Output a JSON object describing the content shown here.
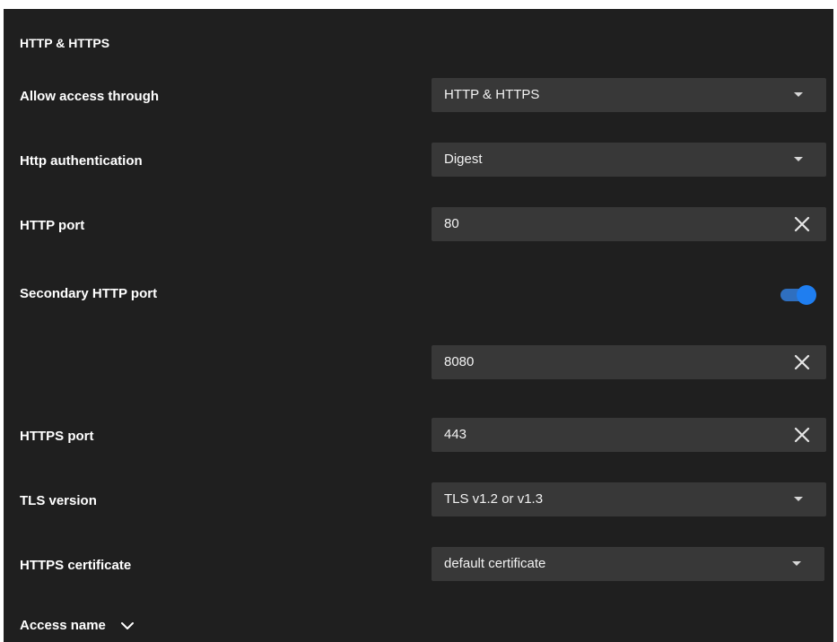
{
  "section": {
    "title": "HTTP & HTTPS"
  },
  "fields": {
    "allow_access": {
      "label": "Allow access through",
      "value": "HTTP & HTTPS"
    },
    "http_auth": {
      "label": "Http authentication",
      "value": "Digest"
    },
    "http_port": {
      "label": "HTTP port",
      "value": "80"
    },
    "secondary_http_port": {
      "label": "Secondary HTTP port",
      "enabled": true,
      "value": "8080"
    },
    "https_port": {
      "label": "HTTPS port",
      "value": "443"
    },
    "tls_version": {
      "label": "TLS version",
      "value": "TLS v1.2 or v1.3"
    },
    "https_certificate": {
      "label": "HTTPS certificate",
      "value": "default certificate"
    }
  },
  "access_name": {
    "label": "Access name",
    "icon": "chevron-down-icon"
  },
  "icons": {
    "clear": "close-icon",
    "dropdown": "caret-down-icon"
  },
  "colors": {
    "panel_bg": "#1f1f1f",
    "control_bg": "#383838",
    "toggle_track": "#2f6fbf",
    "toggle_knob": "#1f7ef0"
  }
}
